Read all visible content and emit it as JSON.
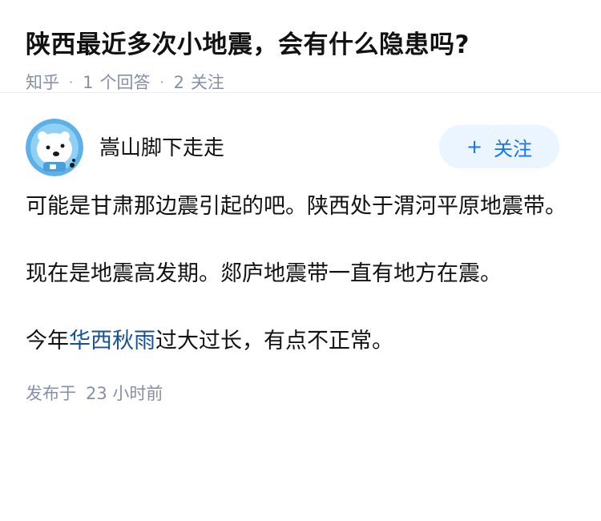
{
  "question": {
    "title": "陕西最近多次小地震，会有什么隐患吗?",
    "source": "知乎",
    "answers_count": "1",
    "answers_label": "个回答",
    "follows_count": "2",
    "follows_label": "关注"
  },
  "answer": {
    "author_name": "嵩山脚下走走",
    "follow_button": {
      "plus": "+",
      "label": "关注"
    },
    "paragraphs": [
      {
        "text": "可能是甘肃那边震引起的吧。陕西处于渭河平原地震带。"
      },
      {
        "text": "现在是地震高发期。郯庐地震带一直有地方在震。"
      },
      {
        "before": "今年",
        "link": "华西秋雨",
        "after": "过大过长，有点不正常。"
      }
    ],
    "published_label": "发布于",
    "published_time": "23 小时前"
  },
  "colors": {
    "link": "#175199",
    "accent": "#1772f6",
    "follow_bg": "#ebf5ff",
    "meta": "#8590a6"
  },
  "icons": {
    "avatar": "polar-bear-astronaut-avatar"
  }
}
